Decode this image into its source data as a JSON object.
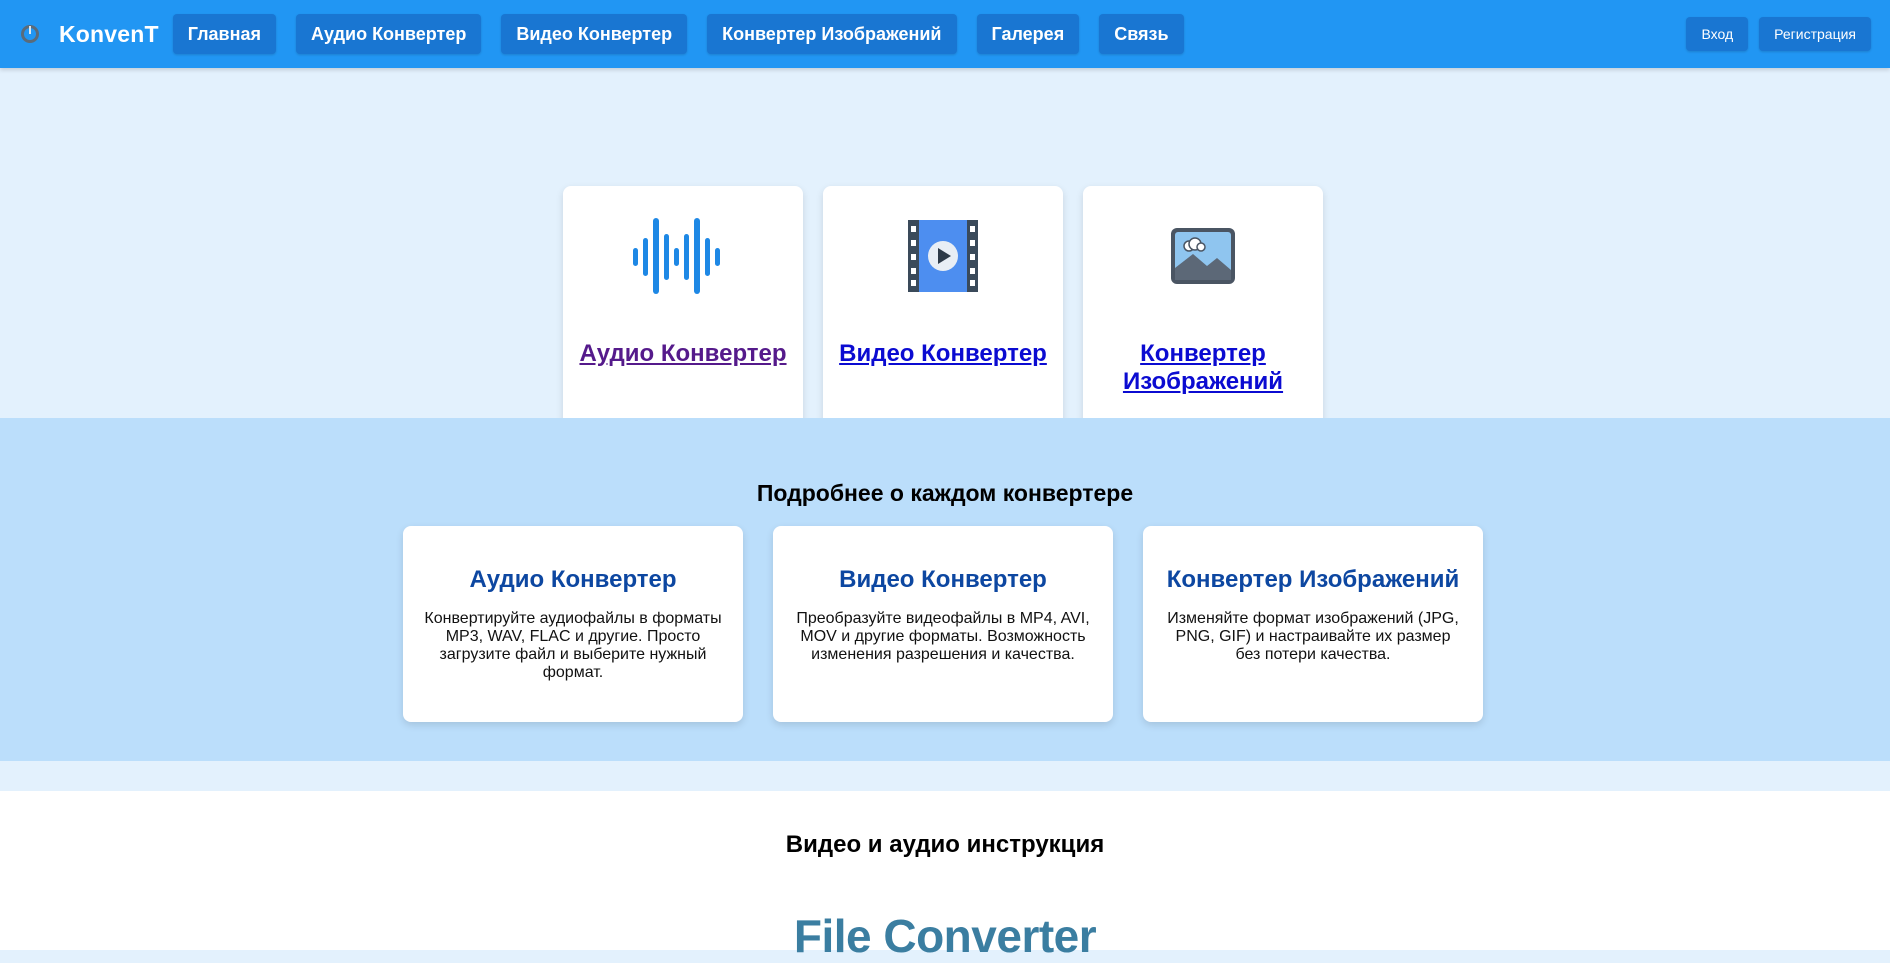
{
  "navbar": {
    "brand": "KonvenT",
    "links": [
      "Главная",
      "Аудио Конвертер",
      "Видео Конвертер",
      "Конвертер Изображений",
      "Галерея",
      "Связь"
    ],
    "login": "Вход",
    "register": "Регистрация"
  },
  "tiles": [
    {
      "label": "Аудио Конвертер",
      "icon": "audio-wave-icon"
    },
    {
      "label": "Видео Конвертер",
      "icon": "video-film-icon"
    },
    {
      "label": "Конвертер Изображений",
      "icon": "image-picture-icon"
    }
  ],
  "details": {
    "title": "Подробнее о каждом конвертере",
    "cards": [
      {
        "title": "Аудио Конвертер",
        "text": "Конвертируйте аудиофайлы в форматы MP3, WAV, FLAC и другие. Просто загрузите файл и выберите нужный формат."
      },
      {
        "title": "Видео Конвертер",
        "text": "Преобразуйте видеофайлы в MP4, AVI, MOV и другие форматы. Возможность изменения разрешения и качества."
      },
      {
        "title": "Конвертер Изображений",
        "text": "Изменяйте формат изображений (JPG, PNG, GIF) и настраивайте их размер без потери качества."
      }
    ]
  },
  "instruction": {
    "title": "Видео и аудио инструкция",
    "video_title": "File Converter"
  },
  "colors": {
    "navbar": "#2196f3",
    "nav_button": "#1976d2",
    "card_title": "#0d47a1",
    "link": "#0b0bd1",
    "visited_link": "#551a8b"
  }
}
